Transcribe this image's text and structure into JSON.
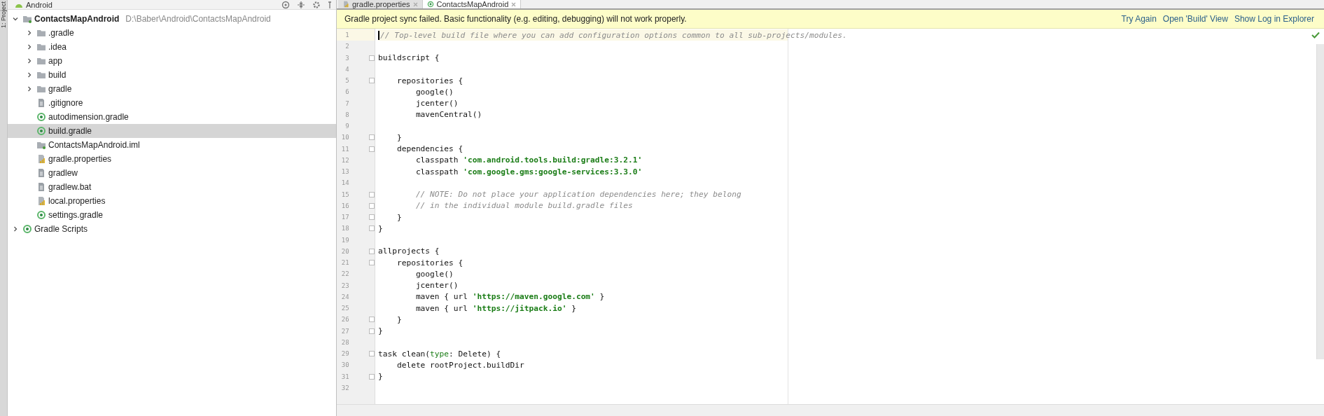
{
  "side_stripe": {
    "label": "1: Project"
  },
  "project_panel": {
    "view_selector": "Android",
    "tree": [
      {
        "label": "ContactsMapAndroid",
        "path": "D:\\Baber\\Android\\ContactsMapAndroid",
        "kind": "module",
        "expanded": true,
        "selected": false,
        "children": [
          {
            "label": ".gradle",
            "kind": "folder",
            "expanded": false,
            "selected": false
          },
          {
            "label": ".idea",
            "kind": "folder",
            "expanded": false,
            "selected": false
          },
          {
            "label": "app",
            "kind": "folder",
            "expanded": false,
            "selected": false
          },
          {
            "label": "build",
            "kind": "folder",
            "expanded": false,
            "selected": false
          },
          {
            "label": "gradle",
            "kind": "folder",
            "expanded": false,
            "selected": false
          },
          {
            "label": ".gitignore",
            "kind": "text",
            "selected": false
          },
          {
            "label": "autodimension.gradle",
            "kind": "gradle",
            "selected": false
          },
          {
            "label": "build.gradle",
            "kind": "gradle",
            "selected": true
          },
          {
            "label": "ContactsMapAndroid.iml",
            "kind": "module",
            "selected": false
          },
          {
            "label": "gradle.properties",
            "kind": "properties",
            "selected": false
          },
          {
            "label": "gradlew",
            "kind": "text",
            "selected": false
          },
          {
            "label": "gradlew.bat",
            "kind": "text",
            "selected": false
          },
          {
            "label": "local.properties",
            "kind": "properties",
            "selected": false
          },
          {
            "label": "settings.gradle",
            "kind": "gradle",
            "selected": false
          }
        ]
      },
      {
        "label": "Gradle Scripts",
        "kind": "gradle",
        "expanded": false,
        "selected": false
      }
    ]
  },
  "editor": {
    "tabs": [
      {
        "label": "gradle.properties",
        "kind": "properties",
        "selected": false
      },
      {
        "label": "ContactsMapAndroid",
        "kind": "gradle",
        "selected": true
      }
    ],
    "banner": {
      "message": "Gradle project sync failed. Basic functionality (e.g. editing, debugging) will not work properly.",
      "actions": [
        "Try Again",
        "Open 'Build' View",
        "Show Log in Explorer"
      ]
    },
    "lines": [
      {
        "number": "1",
        "current": true,
        "fold": false,
        "tokens": [
          {
            "kind": "comment",
            "text": "// Top-level build file where you can add configuration options common to all sub-projects/modules."
          }
        ]
      },
      {
        "number": "2",
        "current": false,
        "fold": false
      },
      {
        "number": "3",
        "current": false,
        "fold": true,
        "tokens": [
          {
            "kind": "plain",
            "text": "buildscript {"
          }
        ]
      },
      {
        "number": "4",
        "current": false,
        "fold": false
      },
      {
        "number": "5",
        "current": false,
        "fold": true,
        "tokens": [
          {
            "kind": "plain",
            "text": "    repositories {"
          }
        ]
      },
      {
        "number": "6",
        "current": false,
        "fold": false,
        "tokens": [
          {
            "kind": "plain",
            "text": "        google()"
          }
        ]
      },
      {
        "number": "7",
        "current": false,
        "fold": false,
        "tokens": [
          {
            "kind": "plain",
            "text": "        jcenter()"
          }
        ]
      },
      {
        "number": "8",
        "current": false,
        "fold": false,
        "tokens": [
          {
            "kind": "plain",
            "text": "        mavenCentral()"
          }
        ]
      },
      {
        "number": "9",
        "current": false,
        "fold": false
      },
      {
        "number": "10",
        "current": false,
        "fold": true,
        "tokens": [
          {
            "kind": "plain",
            "text": "    }"
          }
        ]
      },
      {
        "number": "11",
        "current": false,
        "fold": true,
        "tokens": [
          {
            "kind": "plain",
            "text": "    dependencies {"
          }
        ]
      },
      {
        "number": "12",
        "current": false,
        "fold": false,
        "tokens": [
          {
            "kind": "plain",
            "text": "        classpath "
          },
          {
            "kind": "string",
            "text": "'com.android.tools.build:gradle:3.2.1'"
          }
        ]
      },
      {
        "number": "13",
        "current": false,
        "fold": false,
        "tokens": [
          {
            "kind": "plain",
            "text": "        classpath "
          },
          {
            "kind": "string",
            "text": "'com.google.gms:google-services:3.3.0'"
          }
        ]
      },
      {
        "number": "14",
        "current": false,
        "fold": false
      },
      {
        "number": "15",
        "current": false,
        "fold": true,
        "tokens": [
          {
            "kind": "comment",
            "text": "        // NOTE: Do not place your application dependencies here; they belong"
          }
        ]
      },
      {
        "number": "16",
        "current": false,
        "fold": true,
        "tokens": [
          {
            "kind": "comment",
            "text": "        // in the individual module build.gradle files"
          }
        ]
      },
      {
        "number": "17",
        "current": false,
        "fold": true,
        "tokens": [
          {
            "kind": "plain",
            "text": "    }"
          }
        ]
      },
      {
        "number": "18",
        "current": false,
        "fold": true,
        "tokens": [
          {
            "kind": "plain",
            "text": "}"
          }
        ]
      },
      {
        "number": "19",
        "current": false,
        "fold": false
      },
      {
        "number": "20",
        "current": false,
        "fold": true,
        "tokens": [
          {
            "kind": "plain",
            "text": "allprojects {"
          }
        ]
      },
      {
        "number": "21",
        "current": false,
        "fold": true,
        "tokens": [
          {
            "kind": "plain",
            "text": "    repositories {"
          }
        ]
      },
      {
        "number": "22",
        "current": false,
        "fold": false,
        "tokens": [
          {
            "kind": "plain",
            "text": "        google()"
          }
        ]
      },
      {
        "number": "23",
        "current": false,
        "fold": false,
        "tokens": [
          {
            "kind": "plain",
            "text": "        jcenter()"
          }
        ]
      },
      {
        "number": "24",
        "current": false,
        "fold": false,
        "tokens": [
          {
            "kind": "plain",
            "text": "        maven { url "
          },
          {
            "kind": "string",
            "text": "'https://maven.google.com'"
          },
          {
            "kind": "plain",
            "text": " }"
          }
        ]
      },
      {
        "number": "25",
        "current": false,
        "fold": false,
        "tokens": [
          {
            "kind": "plain",
            "text": "        maven { url "
          },
          {
            "kind": "string",
            "text": "'https://jitpack.io'"
          },
          {
            "kind": "plain",
            "text": " }"
          }
        ]
      },
      {
        "number": "26",
        "current": false,
        "fold": true,
        "tokens": [
          {
            "kind": "plain",
            "text": "    }"
          }
        ]
      },
      {
        "number": "27",
        "current": false,
        "fold": true,
        "tokens": [
          {
            "kind": "plain",
            "text": "}"
          }
        ]
      },
      {
        "number": "28",
        "current": false,
        "fold": false
      },
      {
        "number": "29",
        "current": false,
        "fold": true,
        "tokens": [
          {
            "kind": "plain",
            "text": "task clean("
          },
          {
            "kind": "keyword",
            "text": "type"
          },
          {
            "kind": "plain",
            "text": ": Delete) {"
          }
        ]
      },
      {
        "number": "30",
        "current": false,
        "fold": false,
        "tokens": [
          {
            "kind": "plain",
            "text": "    delete rootProject.buildDir"
          }
        ]
      },
      {
        "number": "31",
        "current": false,
        "fold": true,
        "tokens": [
          {
            "kind": "plain",
            "text": "}"
          }
        ]
      },
      {
        "number": "32",
        "current": false,
        "fold": false
      }
    ]
  }
}
